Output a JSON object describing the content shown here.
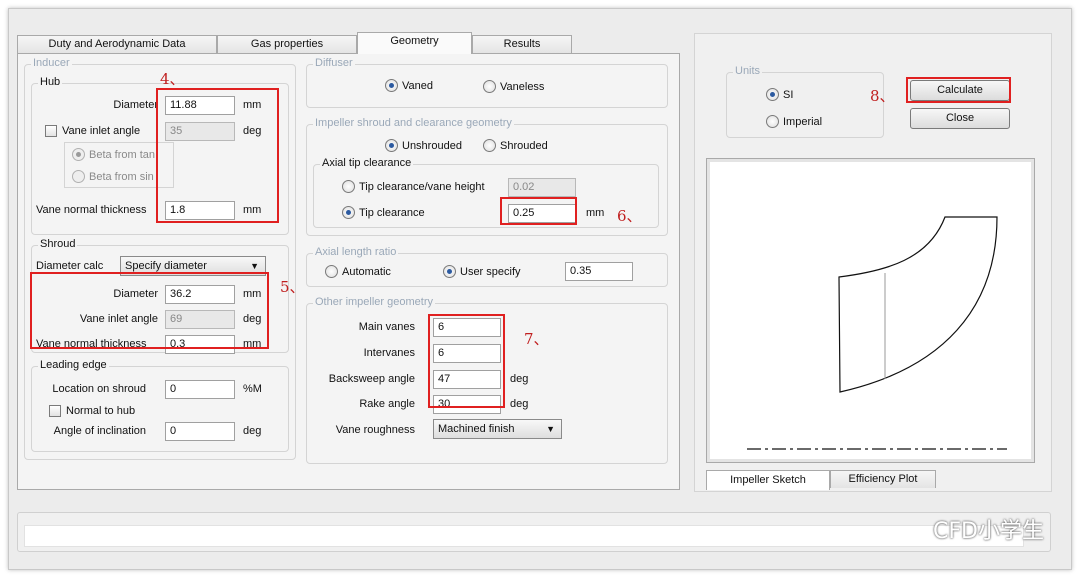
{
  "tabs": [
    "Duty and Aerodynamic Data",
    "Gas properties",
    "Geometry",
    "Results"
  ],
  "active_tab": "Geometry",
  "inducer": {
    "title": "Inducer",
    "hub": {
      "title": "Hub",
      "diameter_label": "Diameter",
      "diameter_value": "11.88",
      "diameter_unit": "mm",
      "vane_inlet_angle_label": "Vane inlet angle",
      "vane_inlet_angle_value": "35",
      "vane_inlet_angle_unit": "deg",
      "beta_tan_label": "Beta from tan",
      "beta_sin_label": "Beta from sin",
      "vane_normal_thickness_label": "Vane normal thickness",
      "vane_normal_thickness_value": "1.8",
      "vane_normal_thickness_unit": "mm"
    },
    "shroud": {
      "title": "Shroud",
      "diameter_calc_label": "Diameter calc",
      "diameter_calc_value": "Specify diameter",
      "diameter_label": "Diameter",
      "diameter_value": "36.2",
      "diameter_unit": "mm",
      "vane_inlet_angle_label": "Vane inlet angle",
      "vane_inlet_angle_value": "69",
      "vane_inlet_angle_unit": "deg",
      "vane_normal_thickness_label": "Vane normal thickness",
      "vane_normal_thickness_value": "0.3",
      "vane_normal_thickness_unit": "mm"
    },
    "leading_edge": {
      "title": "Leading edge",
      "location_label": "Location on shroud",
      "location_value": "0",
      "location_unit": "%M",
      "normal_to_hub_label": "Normal to hub",
      "angle_label": "Angle of inclination",
      "angle_value": "0",
      "angle_unit": "deg"
    }
  },
  "diffuser": {
    "title": "Diffuser",
    "vaned_label": "Vaned",
    "vaneless_label": "Vaneless"
  },
  "shroud_clearance": {
    "title": "Impeller shroud and clearance geometry",
    "unshrouded_label": "Unshrouded",
    "shrouded_label": "Shrouded",
    "axial_tip_title": "Axial tip clearance",
    "tip_vane_height_label": "Tip clearance/vane height",
    "tip_vane_height_value": "0.02",
    "tip_clearance_label": "Tip clearance",
    "tip_clearance_value": "0.25",
    "tip_clearance_unit": "mm"
  },
  "axial_length": {
    "title": "Axial length ratio",
    "automatic_label": "Automatic",
    "user_specify_label": "User specify",
    "value": "0.35"
  },
  "other_geometry": {
    "title": "Other impeller geometry",
    "main_vanes_label": "Main vanes",
    "main_vanes_value": "6",
    "intervanes_label": "Intervanes",
    "intervanes_value": "6",
    "backsweep_label": "Backsweep angle",
    "backsweep_value": "47",
    "backsweep_unit": "deg",
    "rake_label": "Rake angle",
    "rake_value": "30",
    "rake_unit": "deg",
    "roughness_label": "Vane roughness",
    "roughness_value": "Machined finish"
  },
  "units": {
    "title": "Units",
    "si_label": "SI",
    "imperial_label": "Imperial"
  },
  "buttons": {
    "calculate": "Calculate",
    "close": "Close"
  },
  "sketch_tabs": [
    "Impeller Sketch",
    "Efficiency Plot"
  ],
  "annotations": [
    "4、",
    "5、",
    "6、",
    "7、",
    "8、"
  ],
  "watermark": "CFD小学生",
  "colors": {
    "highlight": "#e02020",
    "annotation": "#c02020",
    "radio_dot": "#2c5aa0"
  }
}
